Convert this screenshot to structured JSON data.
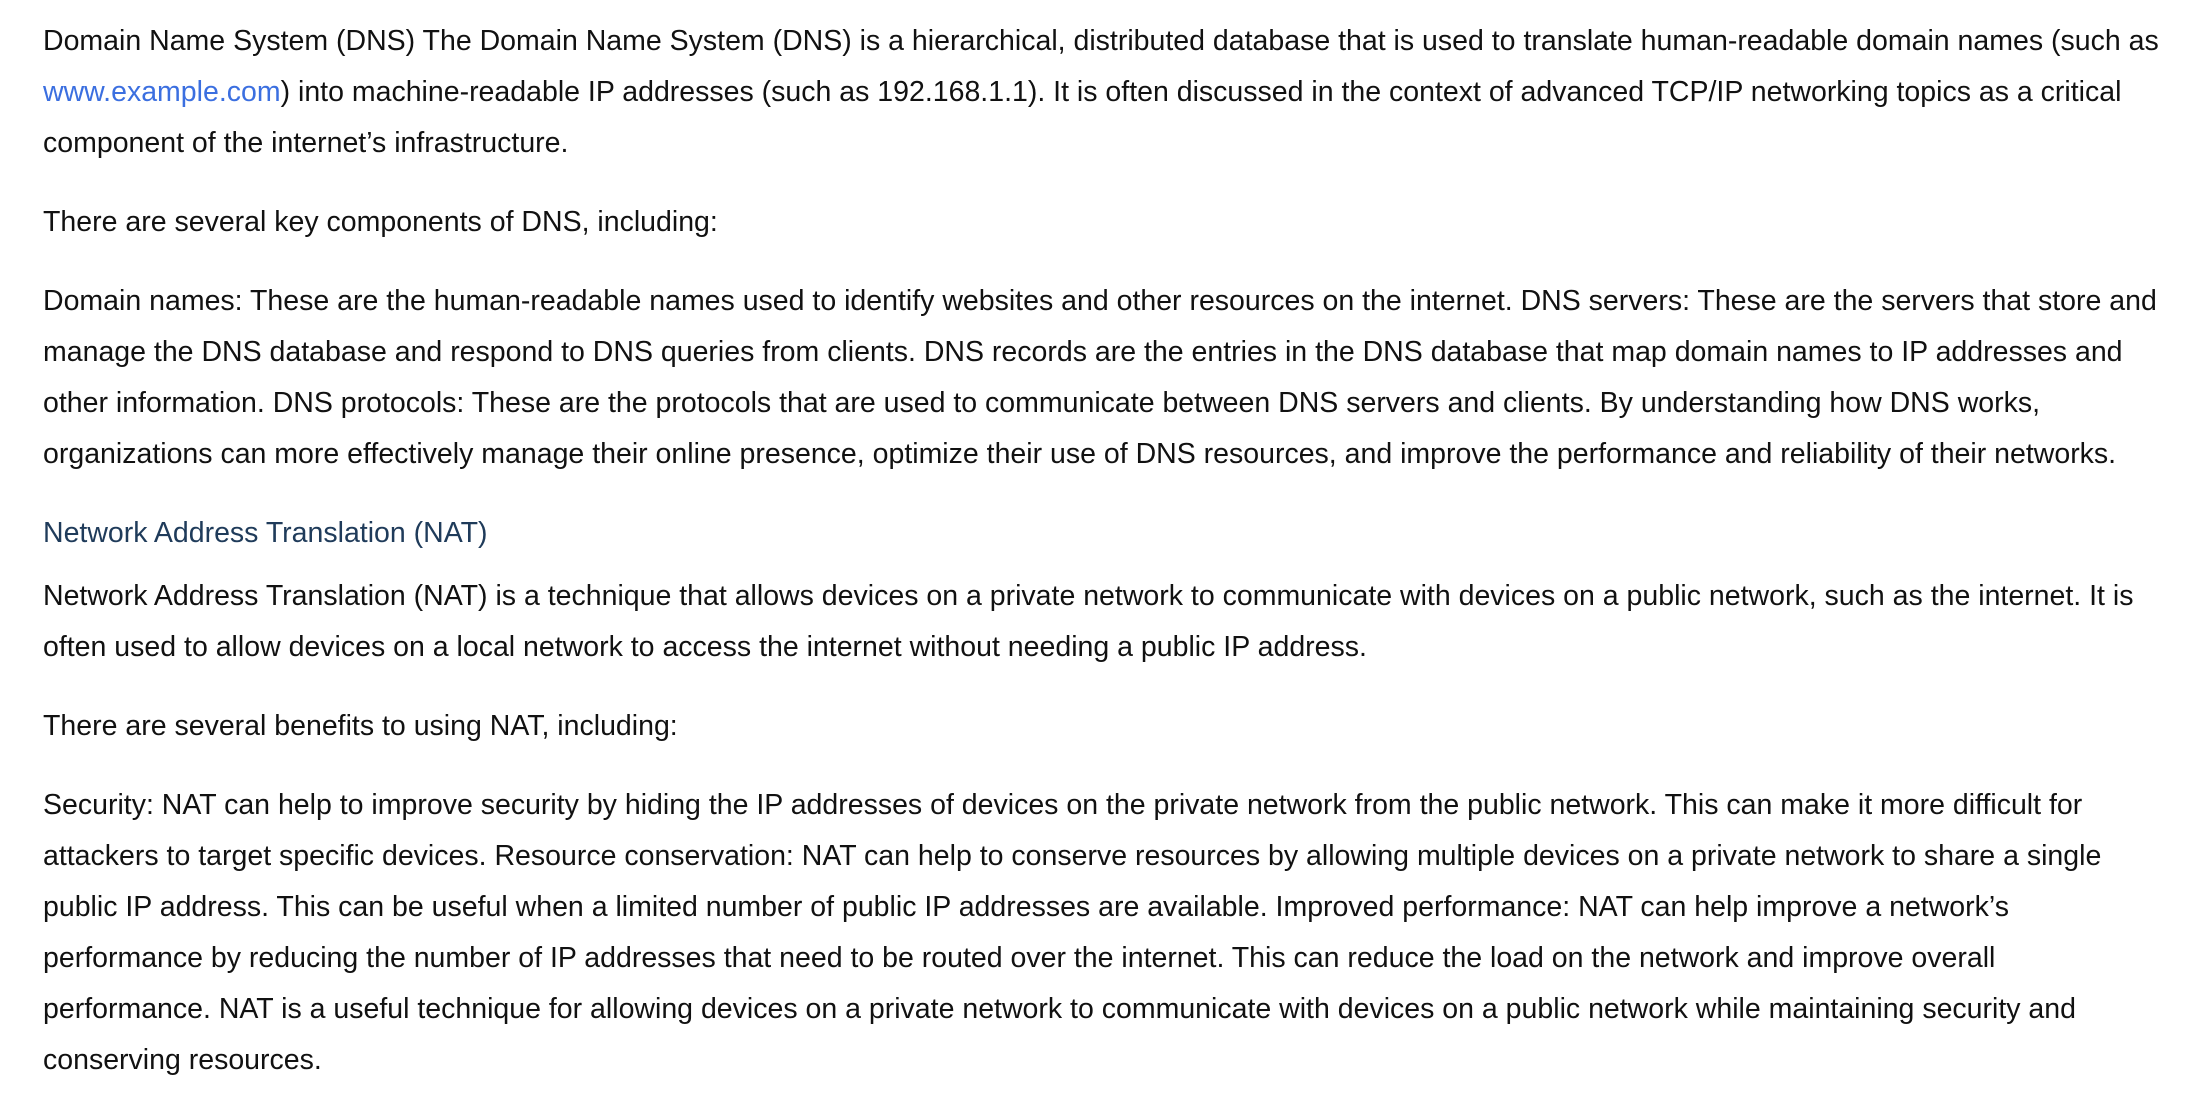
{
  "dns": {
    "intro_before_link": "Domain Name System (DNS) The Domain Name System (DNS) is a hierarchical, distributed database that is used to translate human-readable domain names (such as ",
    "link_text": "www.example.com",
    "intro_after_link": ") into machine-readable IP addresses (such as 192.168.1.1). It is often discussed in the context of advanced TCP/IP networking topics as a critical component of the internet’s infrastructure.",
    "components_lead": "There are several key components of DNS, including:",
    "components_body": "Domain names: These are the human-readable names used to identify websites and other resources on the internet. DNS servers: These are the servers that store and manage the DNS database and respond to DNS queries from clients. DNS records are the entries in the DNS database that map domain names to IP addresses and other information. DNS protocols: These are the protocols that are used to communicate between DNS servers and clients. By understanding how DNS works, organizations can more effectively manage their online presence, optimize their use of DNS resources, and improve the performance and reliability of their networks."
  },
  "nat": {
    "heading": "Network Address Translation (NAT)",
    "intro": "Network Address Translation (NAT) is a technique that allows devices on a private network to communicate with devices on a public network, such as the internet. It is often used to allow devices on a local network to access the internet without needing a public IP address.",
    "benefits_lead": "There are several benefits to using NAT, including:",
    "benefits_body": "Security: NAT can help to improve security by hiding the IP addresses of devices on the private network from the public network. This can make it more difficult for attackers to target specific devices. Resource conservation: NAT can help to conserve resources by allowing multiple devices on a private network to share a single public IP address. This can be useful when a limited number of public IP addresses are available. Improved performance: NAT can help improve a network’s performance by reducing the number of IP addresses that need to be routed over the internet. This can reduce the load on the network and improve overall performance. NAT is a useful technique for allowing devices on a private network to communicate with devices on a public network while maintaining security and conserving resources."
  },
  "colors": {
    "link": "#3b6fe0",
    "heading": "#1f3b5a",
    "text": "#111111"
  }
}
